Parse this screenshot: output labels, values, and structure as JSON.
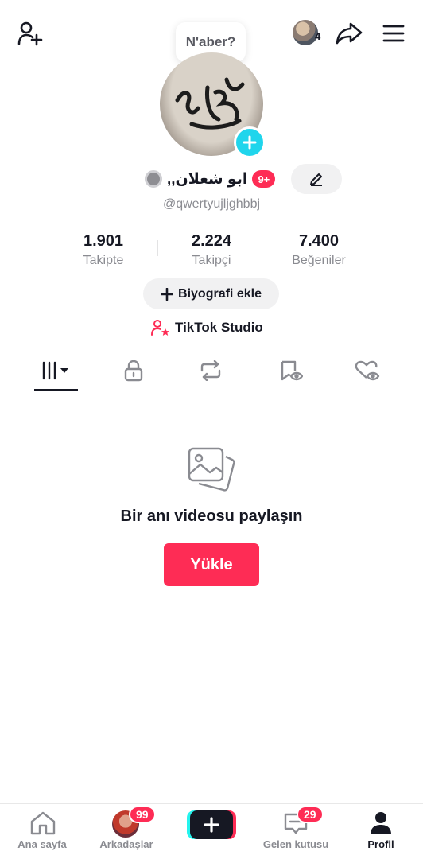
{
  "header": {
    "story_bubble": "N'aber?",
    "follower_avatar_count": "4"
  },
  "profile": {
    "display_name": "ابو شعلان,,",
    "notification_badge": "9+",
    "username": "@qwertyujljghbbj",
    "stats": [
      {
        "value": "1.901",
        "label": "Takipte"
      },
      {
        "value": "2.224",
        "label": "Takipçi"
      },
      {
        "value": "7.400",
        "label": "Beğeniler"
      }
    ],
    "bio_button": "Biyografi ekle",
    "studio_link": "TikTok Studio"
  },
  "tabs": [
    "videos-grid",
    "private",
    "reposts",
    "favorites",
    "liked"
  ],
  "empty_state": {
    "title": "Bir anı videosu paylaşın",
    "upload_button": "Yükle"
  },
  "bottom_nav": {
    "items": [
      {
        "label": "Ana sayfa"
      },
      {
        "label": "Arkadaşlar",
        "badge": "99"
      },
      {
        "label": ""
      },
      {
        "label": "Gelen kutusu",
        "badge": "29"
      },
      {
        "label": "Profil"
      }
    ]
  },
  "colors": {
    "accent": "#fe2c55",
    "cyan": "#20d5ec",
    "text": "#161823",
    "muted": "#8a8b91"
  }
}
